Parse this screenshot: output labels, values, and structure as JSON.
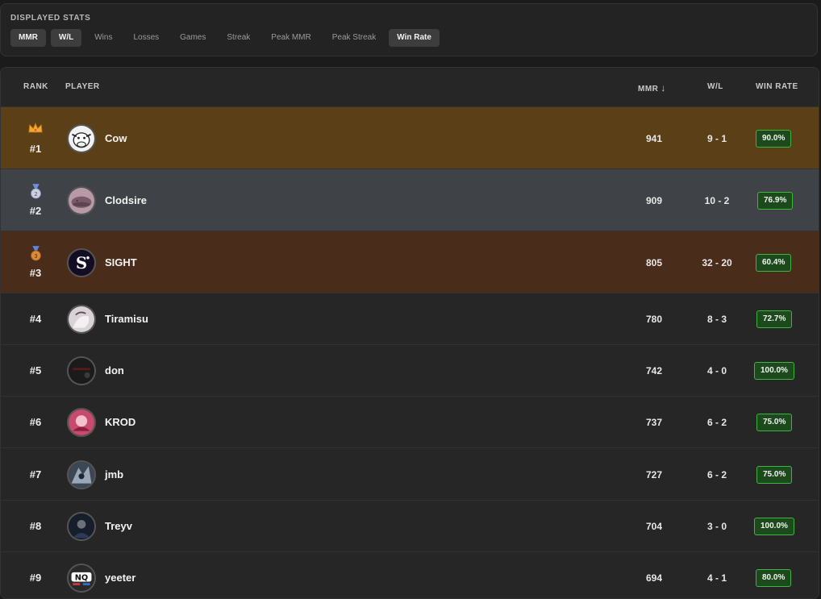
{
  "stats": {
    "title": "DISPLAYED STATS",
    "chips": [
      {
        "label": "MMR",
        "active": true
      },
      {
        "label": "W/L",
        "active": true
      },
      {
        "label": "Wins",
        "active": false
      },
      {
        "label": "Losses",
        "active": false
      },
      {
        "label": "Games",
        "active": false
      },
      {
        "label": "Streak",
        "active": false
      },
      {
        "label": "Peak MMR",
        "active": false
      },
      {
        "label": "Peak Streak",
        "active": false
      },
      {
        "label": "Win Rate",
        "active": true
      }
    ]
  },
  "table": {
    "headers": {
      "rank": "RANK",
      "player": "PLAYER",
      "mmr": "MMR",
      "sort_icon": "↓",
      "wl": "W/L",
      "win_rate": "WIN RATE"
    },
    "rows": [
      {
        "rank": "#1",
        "medal": "crown-icon",
        "player": "Cow",
        "mmr": "941",
        "wl": "9 - 1",
        "win_rate": "90.0%"
      },
      {
        "rank": "#2",
        "medal": "silver-medal-icon",
        "player": "Clodsire",
        "mmr": "909",
        "wl": "10 - 2",
        "win_rate": "76.9%"
      },
      {
        "rank": "#3",
        "medal": "bronze-medal-icon",
        "player": "SIGHT",
        "mmr": "805",
        "wl": "32 - 20",
        "win_rate": "60.4%"
      },
      {
        "rank": "#4",
        "player": "Tiramisu",
        "mmr": "780",
        "wl": "8 - 3",
        "win_rate": "72.7%"
      },
      {
        "rank": "#5",
        "player": "don",
        "mmr": "742",
        "wl": "4 - 0",
        "win_rate": "100.0%"
      },
      {
        "rank": "#6",
        "player": "KROD",
        "mmr": "737",
        "wl": "6 - 2",
        "win_rate": "75.0%"
      },
      {
        "rank": "#7",
        "player": "jmb",
        "mmr": "727",
        "wl": "6 - 2",
        "win_rate": "75.0%"
      },
      {
        "rank": "#8",
        "player": "Treyv",
        "mmr": "704",
        "wl": "3 - 0",
        "win_rate": "100.0%"
      },
      {
        "rank": "#9",
        "player": "yeeter",
        "mmr": "694",
        "wl": "4 - 1",
        "win_rate": "80.0%"
      }
    ]
  },
  "colors": {
    "gold_row": "#5b3f16",
    "silver_row": "#3f4246",
    "bronze_row": "#4a2c1b",
    "winrate_border": "#3fb53f"
  }
}
